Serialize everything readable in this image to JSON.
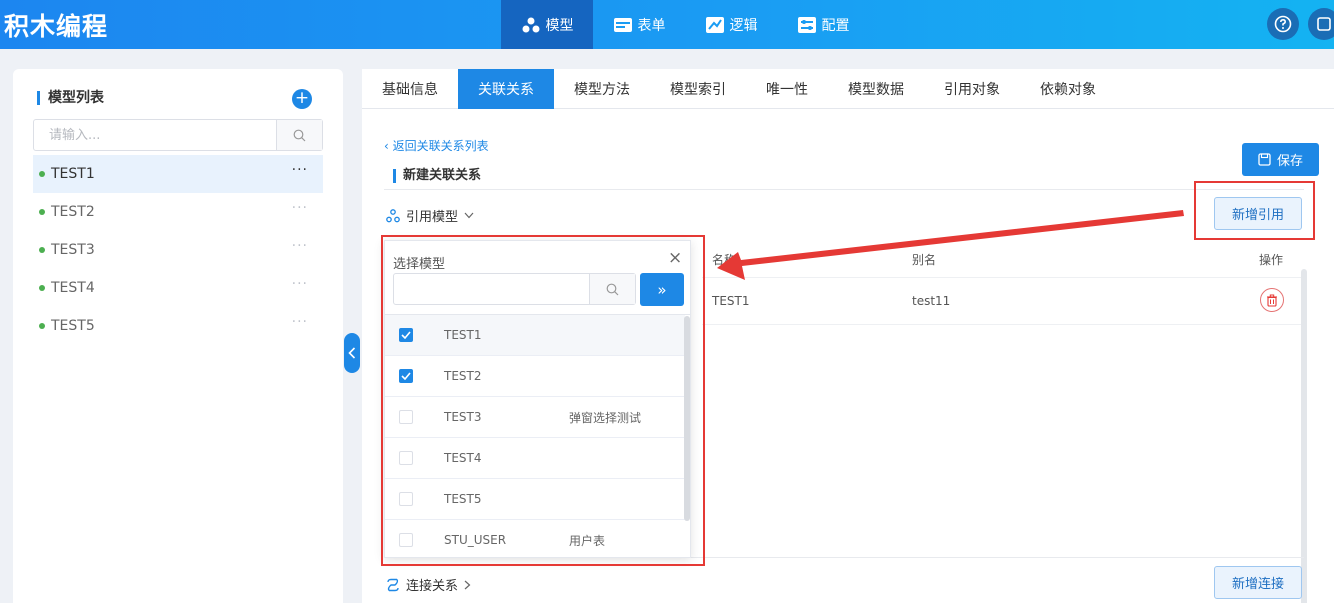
{
  "header": {
    "app_title": "积木编程",
    "nav": [
      {
        "label": "模型",
        "icon": "model-icon",
        "active": true
      },
      {
        "label": "表单",
        "icon": "form-icon"
      },
      {
        "label": "逻辑",
        "icon": "logic-icon"
      },
      {
        "label": "配置",
        "icon": "config-icon"
      }
    ]
  },
  "sidebar": {
    "title": "模型列表",
    "search_placeholder": "请输入...",
    "items": [
      {
        "label": "TEST1",
        "active": true
      },
      {
        "label": "TEST2"
      },
      {
        "label": "TEST3"
      },
      {
        "label": "TEST4"
      },
      {
        "label": "TEST5"
      }
    ],
    "more_label": "···"
  },
  "tabs": [
    "基础信息",
    "关联关系",
    "模型方法",
    "模型索引",
    "唯一性",
    "模型数据",
    "引用对象",
    "依赖对象"
  ],
  "active_tab": "关联关系",
  "main": {
    "back_link": "返回关联关系列表",
    "section_title": "新建关联关系",
    "save_label": "保存",
    "ref_section_label": "引用模型",
    "add_ref_label": "新增引用",
    "table": {
      "headers": [
        "名称",
        "别名",
        "操作"
      ],
      "rows": [
        {
          "name": "TEST1",
          "alias": "test11"
        }
      ]
    },
    "conn_section_label": "连接关系",
    "add_conn_label": "新增连接"
  },
  "dropdown": {
    "title": "选择模型",
    "close": "×",
    "go_label": "»",
    "rows": [
      {
        "name": "TEST1",
        "desc": "",
        "checked": true
      },
      {
        "name": "TEST2",
        "desc": "",
        "checked": true
      },
      {
        "name": "TEST3",
        "desc": "弹窗选择测试",
        "checked": false
      },
      {
        "name": "TEST4",
        "desc": "",
        "checked": false
      },
      {
        "name": "TEST5",
        "desc": "",
        "checked": false
      },
      {
        "name": "STU_USER",
        "desc": "用户表",
        "checked": false
      }
    ]
  },
  "colors": {
    "primary": "#1e88e5",
    "highlight": "#e53935",
    "status_dot": "#4caf50"
  }
}
